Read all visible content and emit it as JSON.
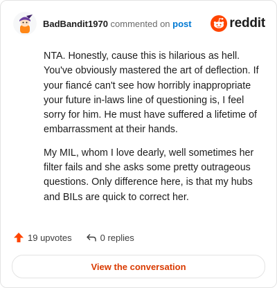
{
  "comment": {
    "username": "BadBandit1970",
    "verb": "commented on",
    "post_link": "post",
    "paragraphs": [
      "NTA. Honestly, cause this is hilarious as hell. You've obviously mastered the art of deflection. If your fiancé can't see how horribly inappropriate your future in-laws line of questioning is, I feel sorry for him. He must have suffered a lifetime of embarrassment at their hands.",
      "My MIL, whom I love dearly, well sometimes her filter fails and she asks some pretty outrageous questions. Only difference here, is that my hubs and BILs are quick to correct her."
    ],
    "upvotes": "19 upvotes",
    "replies": "0 replies"
  },
  "brand": {
    "name": "reddit",
    "icon": "reddit-logo-icon",
    "color": "#ff4500"
  },
  "cta": {
    "label": "View the conversation"
  },
  "colors": {
    "accent": "#d93a00",
    "link": "#0079d3",
    "upvote": "#ff4500"
  }
}
